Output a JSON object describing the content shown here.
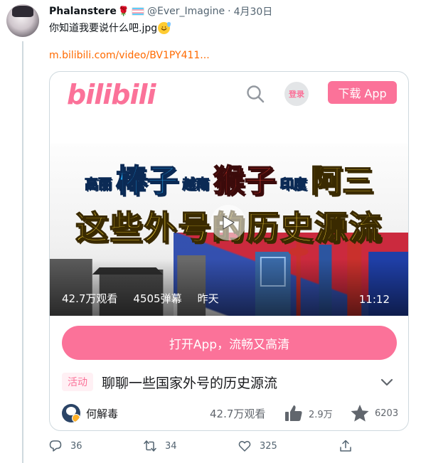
{
  "tweet": {
    "display_name": "Phalanstere",
    "rose_emoji": "🌹",
    "handle": "@Ever_Imagine",
    "separator": "·",
    "date": "4月30日",
    "text": "你知道我要说什么吧.jpg",
    "text_emoji": "😅",
    "link": "m.bilibili.com/video/BV1PY411..."
  },
  "card": {
    "logo": "bilibili",
    "login_label": "登录",
    "download_label": "下载 App",
    "thumbnail": {
      "title_line1": [
        {
          "text": "高丽",
          "style": "small"
        },
        {
          "text": "棒子",
          "style": "big-blue"
        },
        {
          "text": "越南",
          "style": "small"
        },
        {
          "text": "猴子",
          "style": "big-red"
        },
        {
          "text": "印度",
          "style": "small"
        },
        {
          "text": "阿三",
          "style": "big-yellow"
        }
      ],
      "title_line2": "这些外号的历史源流",
      "views": "42.7万观看",
      "danmaku": "4505弹幕",
      "posted": "昨天",
      "duration": "11:12"
    },
    "open_app_label": "打开App，流畅又高清",
    "badge": "活动",
    "video_title": "聊聊一些国家外号的历史源流",
    "author": "何解毒",
    "view_count": "42.7万观看",
    "like_count": "2.9万",
    "favorite_count": "6203"
  },
  "actions": {
    "reply_count": "36",
    "retweet_count": "34",
    "like_count": "325"
  },
  "colors": {
    "bili_pink": "#fb7299",
    "link_orange": "#ff6a00",
    "muted": "#536471"
  },
  "icons": [
    "more-icon",
    "search-icon",
    "play-icon",
    "chevron-down-icon",
    "like-icon",
    "star-icon",
    "reply-icon",
    "retweet-icon",
    "heart-icon",
    "share-icon"
  ]
}
